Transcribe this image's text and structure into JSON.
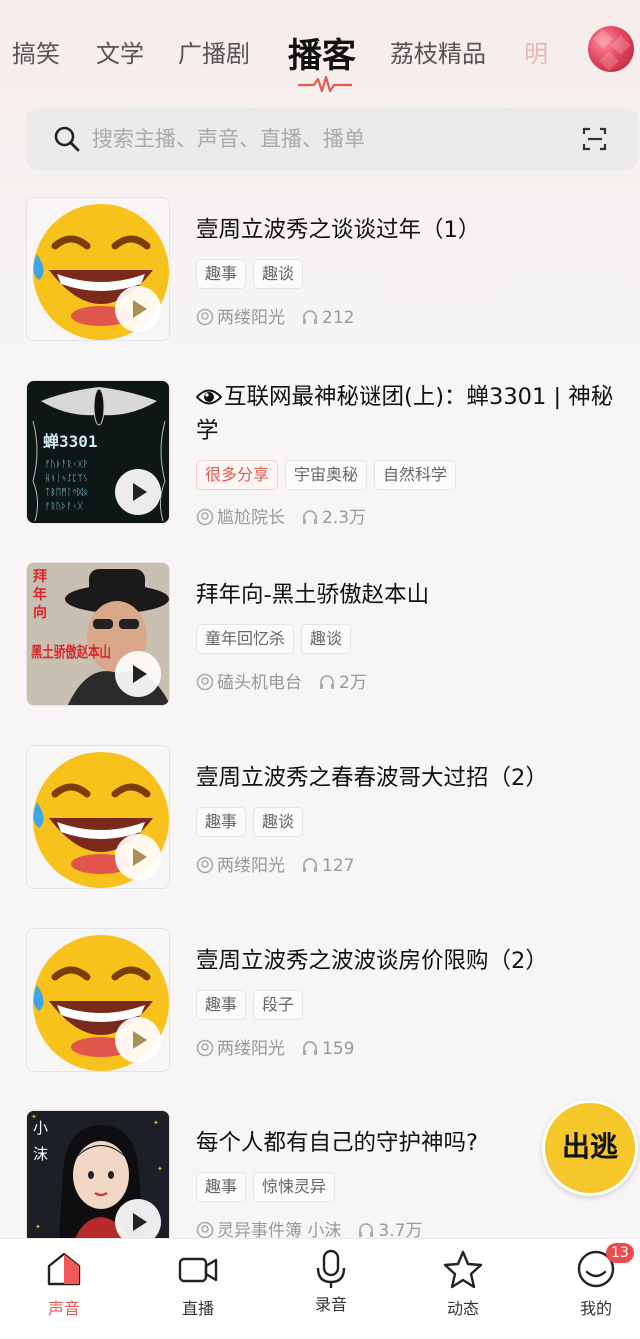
{
  "tabs": [
    {
      "label": "搞笑"
    },
    {
      "label": "文学"
    },
    {
      "label": "广播剧"
    },
    {
      "label": "播客"
    },
    {
      "label": "荔枝精品"
    },
    {
      "label": "明"
    }
  ],
  "search": {
    "placeholder": "搜索主播、声音、直播、播单"
  },
  "items": [
    {
      "title": "壹周立波秀之谈谈过年（1）",
      "tags": [
        "趣事",
        "趣谈"
      ],
      "author": "两缕阳光",
      "plays": "212"
    },
    {
      "title": "互联网最神秘谜团(上)：蝉3301 | 神秘学",
      "tags": [
        "很多分享",
        "宇宙奥秘",
        "自然科学"
      ],
      "author": "尴尬院长",
      "plays": "2.3万",
      "cover_text": "蝉3301"
    },
    {
      "title": "拜年向-黑土骄傲赵本山",
      "tags": [
        "童年回忆杀",
        "趣谈"
      ],
      "author": "磕头机电台",
      "plays": "2万",
      "cover_text": "黑土骄傲赵本山"
    },
    {
      "title": "壹周立波秀之春春波哥大过招（2）",
      "tags": [
        "趣事",
        "趣谈"
      ],
      "author": "两缕阳光",
      "plays": "127"
    },
    {
      "title": "壹周立波秀之波波谈房价限购（2）",
      "tags": [
        "趣事",
        "段子"
      ],
      "author": "两缕阳光",
      "plays": "159"
    },
    {
      "title": "每个人都有自己的守护神吗?",
      "tags": [
        "趣事",
        "惊悚灵异"
      ],
      "author": "灵异事件簿 小沫",
      "plays": "3.7万",
      "cover_text": "小沫"
    }
  ],
  "float_button": {
    "label": "出逃"
  },
  "bottom_nav": [
    {
      "label": "声音"
    },
    {
      "label": "直播"
    },
    {
      "label": "录音"
    },
    {
      "label": "动态"
    },
    {
      "label": "我的",
      "badge": "13"
    }
  ],
  "colors": {
    "accent": "#e25b4f",
    "tag_hot": "#e25b4f",
    "badge": "#ec4c4c",
    "float_button": "#f5c72a"
  }
}
